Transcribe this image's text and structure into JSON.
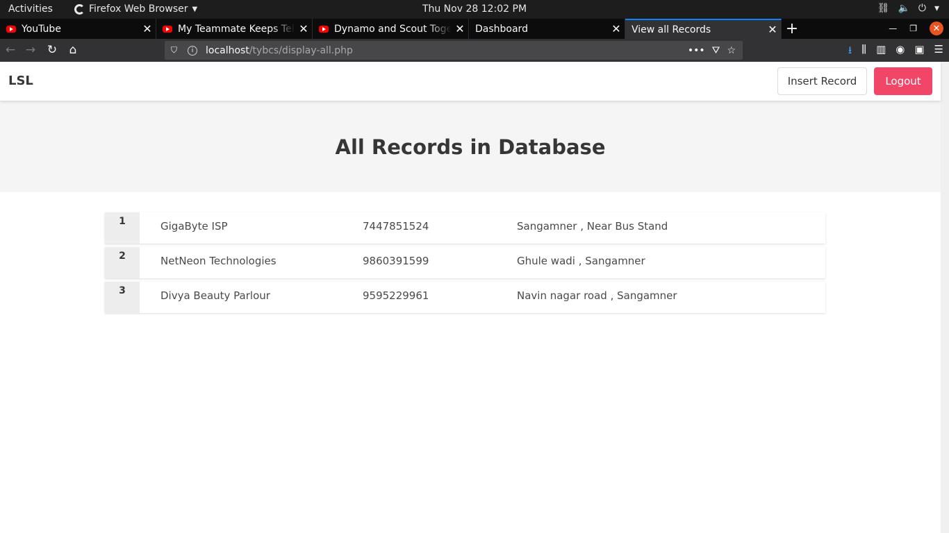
{
  "system": {
    "activities": "Activities",
    "app_name": "Firefox Web Browser",
    "clock": "Thu Nov 28  12:02 PM"
  },
  "tabs": [
    {
      "label": "YouTube",
      "favicon": "youtube-icon"
    },
    {
      "label": "My Teammate Keeps Telling",
      "favicon": "youtube-icon"
    },
    {
      "label": "Dynamo and Scout Together",
      "favicon": "youtube-icon"
    },
    {
      "label": "Dashboard",
      "favicon": ""
    },
    {
      "label": "View all Records",
      "favicon": "",
      "active": true
    }
  ],
  "urlbar": {
    "host": "localhost",
    "path": "/tybcs/display-all.php"
  },
  "site": {
    "brand": "LSL",
    "insert_label": "Insert Record",
    "logout_label": "Logout",
    "heading": "All Records in Database"
  },
  "records": [
    {
      "id": "1",
      "name": "GigaByte ISP",
      "phone": "7447851524",
      "address": "Sangamner , Near Bus Stand"
    },
    {
      "id": "2",
      "name": "NetNeon Technologies",
      "phone": "9860391599",
      "address": "Ghule wadi , Sangamner"
    },
    {
      "id": "3",
      "name": "Divya Beauty Parlour",
      "phone": "9595229961",
      "address": "Navin nagar road , Sangamner"
    }
  ],
  "colors": {
    "accent_tab": "#0a84ff",
    "logout_bg": "#f14668",
    "hero_bg": "#f5f5f5"
  }
}
